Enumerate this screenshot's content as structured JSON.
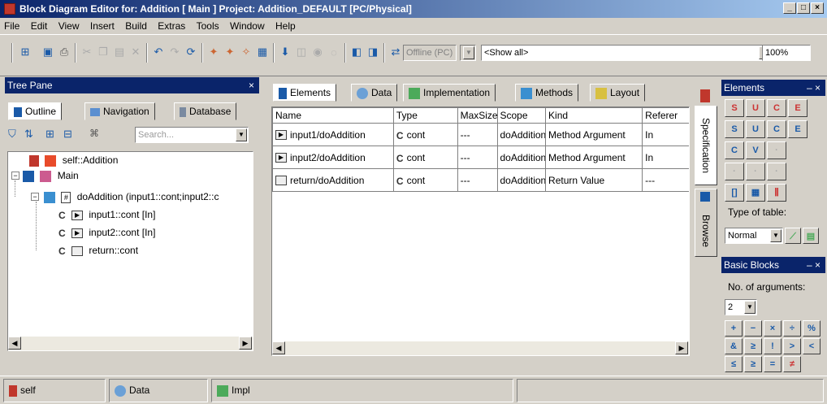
{
  "window": {
    "title": "Block Diagram Editor for: Addition [ Main ] Project: Addition_DEFAULT [PC/Physical]"
  },
  "menu": [
    "File",
    "Edit",
    "View",
    "Insert",
    "Build",
    "Extras",
    "Tools",
    "Window",
    "Help"
  ],
  "toolbar": {
    "online_status": "Offline (PC)",
    "filter": "<Show all>",
    "zoom": "100%"
  },
  "tree_pane": {
    "title": "Tree Pane",
    "tabs": [
      "Outline",
      "Navigation",
      "Database"
    ],
    "search_placeholder": "Search...",
    "nodes": [
      {
        "label": "self::Addition"
      },
      {
        "label": "Main"
      },
      {
        "label": "doAddition (input1::cont;input2::c"
      },
      {
        "label": "input1::cont [In]"
      },
      {
        "label": "input2::cont [In]"
      },
      {
        "label": "return::cont"
      }
    ]
  },
  "editor": {
    "tabs": [
      "Elements",
      "Data",
      "Implementation",
      "Methods",
      "Layout"
    ],
    "columns": [
      "Name",
      "Type",
      "MaxSize",
      "Scope",
      "Kind",
      "Referer"
    ],
    "rows": [
      {
        "name": "input1/doAddition",
        "type": "cont",
        "maxsize": "---",
        "scope": "doAddition",
        "kind": "Method Argument",
        "ref": "In"
      },
      {
        "name": "input2/doAddition",
        "type": "cont",
        "maxsize": "---",
        "scope": "doAddition",
        "kind": "Method Argument",
        "ref": "In"
      },
      {
        "name": "return/doAddition",
        "type": "cont",
        "maxsize": "---",
        "scope": "doAddition",
        "kind": "Return Value",
        "ref": "---"
      }
    ]
  },
  "side_tabs": [
    "Specification",
    "Browse"
  ],
  "elements_pane": {
    "title": "Elements",
    "type_of_table_label": "Type of table:",
    "type_of_table_value": "Normal"
  },
  "basic_blocks_pane": {
    "title": "Basic Blocks",
    "num_args_label": "No. of arguments:",
    "num_args_value": "2",
    "operators": [
      "+",
      "−",
      "×",
      "÷",
      "%",
      "&",
      "≥",
      "!",
      ">",
      "<",
      "≤",
      "≥",
      "=",
      "≠"
    ]
  },
  "status": {
    "items": [
      "self",
      "Data",
      "Impl"
    ]
  },
  "colors": {
    "title_active": "#0a246a",
    "face": "#d4d0c8",
    "brand_red": "#c0372c"
  }
}
